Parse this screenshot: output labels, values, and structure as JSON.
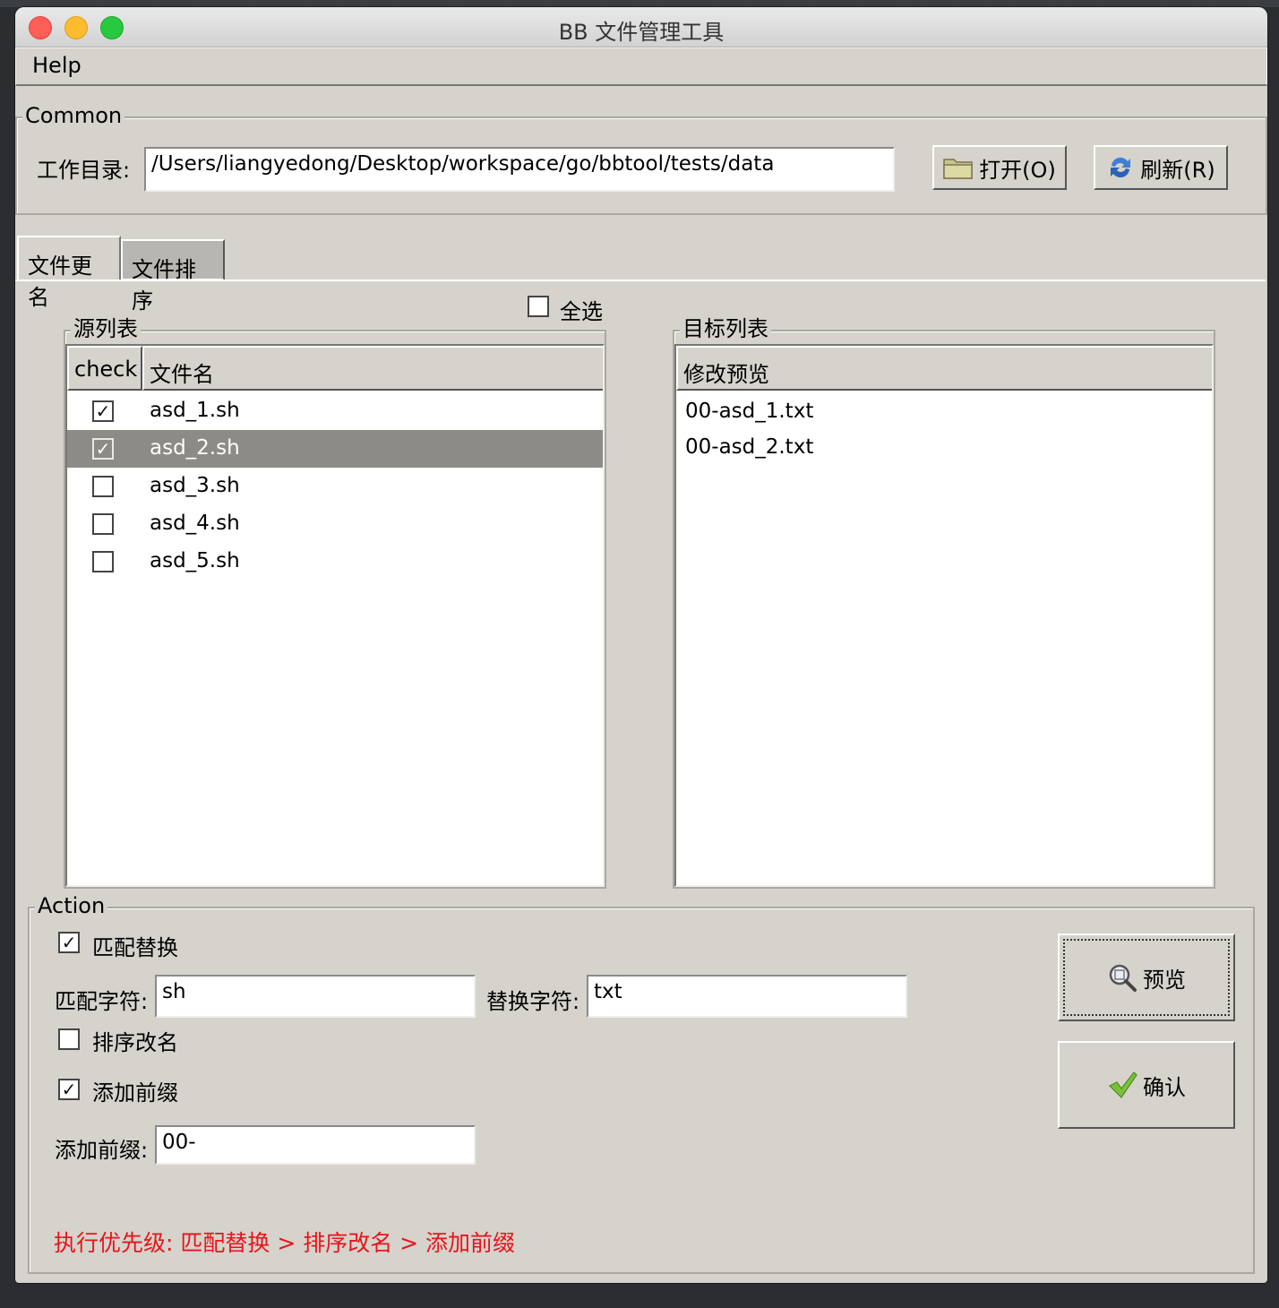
{
  "window": {
    "title": "BB 文件管理工具"
  },
  "menu": {
    "help": "Help"
  },
  "common": {
    "group_title": "Common",
    "dir_label": "工作目录:",
    "dir_value": "/Users/liangyedong/Desktop/workspace/go/bbtool/tests/data",
    "open_label": "打开(O)",
    "refresh_label": "刷新(R)"
  },
  "tabs": [
    {
      "label": "文件更名"
    },
    {
      "label": "文件排序"
    }
  ],
  "select_all": {
    "label": "全选",
    "checked": false
  },
  "source": {
    "group_title": "源列表",
    "col_check": "check",
    "col_name": "文件名",
    "rows": [
      {
        "name": "asd_1.sh",
        "checked": "✓"
      },
      {
        "name": "asd_2.sh",
        "checked": "✓"
      },
      {
        "name": "asd_3.sh",
        "checked": ""
      },
      {
        "name": "asd_4.sh",
        "checked": ""
      },
      {
        "name": "asd_5.sh",
        "checked": ""
      }
    ]
  },
  "target": {
    "group_title": "目标列表",
    "col_preview": "修改预览",
    "rows": [
      {
        "name": "00-asd_1.txt"
      },
      {
        "name": "00-asd_2.txt"
      }
    ]
  },
  "action": {
    "group_title": "Action",
    "match_replace": {
      "label": "匹配替换",
      "checked": "✓"
    },
    "match_label": "匹配字符:",
    "match_value": "sh",
    "replace_label": "替换字符:",
    "replace_value": "txt",
    "sort_rename": {
      "label": "排序改名",
      "checked": ""
    },
    "add_prefix": {
      "label": "添加前缀",
      "checked": "✓"
    },
    "prefix_label": "添加前缀:",
    "prefix_value": "00-",
    "preview_label": "预览",
    "confirm_label": "确认",
    "priority_text": "执行优先级:  匹配替换 > 排序改名  > 添加前缀"
  }
}
